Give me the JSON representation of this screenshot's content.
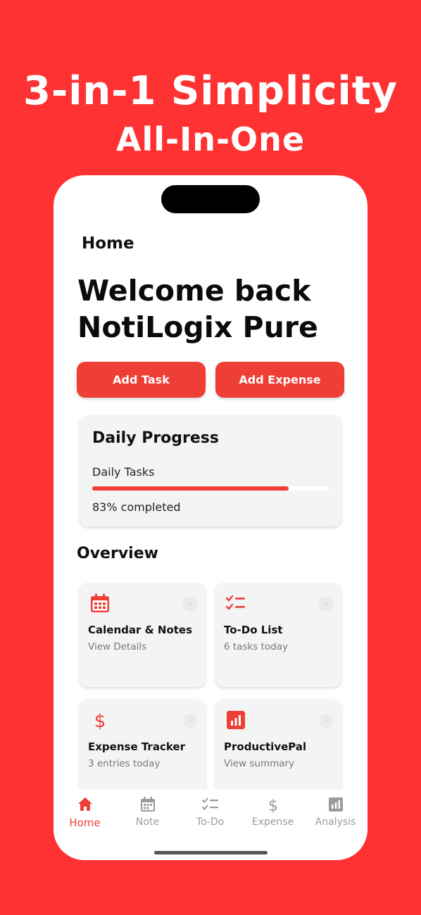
{
  "promo": {
    "line1": "3-in-1 Simplicity",
    "line2": "All-In-One"
  },
  "header": {
    "title": "Home"
  },
  "welcome": {
    "line1": "Welcome back",
    "line2": "NotiLogix Pure"
  },
  "actions": {
    "add_task": "Add Task",
    "add_expense": "Add Expense"
  },
  "progress": {
    "title": "Daily Progress",
    "label": "Daily Tasks",
    "value": 0.83,
    "text": "83%  completed"
  },
  "overview": {
    "title": "Overview",
    "tiles": [
      {
        "name": "Calendar & Notes",
        "sub": "View Details",
        "icon": "calendar-icon"
      },
      {
        "name": "To-Do List",
        "sub": "6 tasks today",
        "icon": "checklist-icon"
      },
      {
        "name": "Expense Tracker",
        "sub": "3 entries today",
        "icon": "dollar-icon"
      },
      {
        "name": "ProductivePal",
        "sub": "View summary",
        "icon": "bar-chart-icon"
      }
    ]
  },
  "tabs": [
    {
      "label": "Home",
      "icon": "home-icon",
      "active": true
    },
    {
      "label": "Note",
      "icon": "calendar-icon",
      "active": false
    },
    {
      "label": "To-Do",
      "icon": "checklist-icon",
      "active": false
    },
    {
      "label": "Expense",
      "icon": "dollar-icon",
      "active": false
    },
    {
      "label": "Analysis",
      "icon": "bar-chart-icon",
      "active": false
    }
  ],
  "colors": {
    "background": "#fe3133",
    "accent": "#ef3e36",
    "inactive": "#9b9b9b"
  }
}
